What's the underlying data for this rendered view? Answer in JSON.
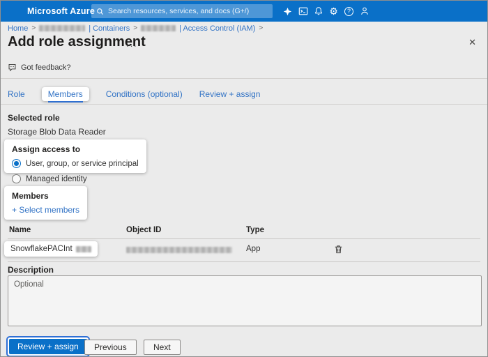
{
  "colors": {
    "topbar_blue": "#0a70c8",
    "accent_blue": "#0078d4",
    "link_blue": "#3273c5",
    "page_dim_gray": "#ebebeb",
    "highlight_white": "#ffffff"
  },
  "topbar": {
    "brand": "Microsoft Azure",
    "search_placeholder": "Search resources, services, and docs (G+/)",
    "gear_glyph": "⚙",
    "help_glyph": "?"
  },
  "breadcrumb": {
    "home": "Home",
    "separator": ">",
    "containers_label": "| Containers",
    "iam_label": "| Access Control (IAM)"
  },
  "page": {
    "title": "Add role assignment",
    "more_glyph": "···",
    "close_glyph": "✕",
    "feedback_label": "Got feedback?"
  },
  "tabs": [
    {
      "label": "Role",
      "active": false
    },
    {
      "label": "Members",
      "active": true
    },
    {
      "label": "Conditions (optional)",
      "active": false
    },
    {
      "label": "Review + assign",
      "active": false
    }
  ],
  "selected_role": {
    "label": "Selected role",
    "value": "Storage Blob Data Reader"
  },
  "assign_access": {
    "label": "Assign access to",
    "options": [
      {
        "label": "User, group, or service principal",
        "selected": true
      },
      {
        "label": "Managed identity",
        "selected": false
      }
    ]
  },
  "members": {
    "label": "Members",
    "select_link": "+ Select members"
  },
  "table": {
    "headers": [
      "Name",
      "Object ID",
      "Type"
    ],
    "rows": [
      {
        "name": "SnowflakePACInt",
        "type": "App"
      }
    ]
  },
  "description": {
    "label": "Description",
    "placeholder": "Optional"
  },
  "footer": {
    "review_assign": "Review + assign",
    "previous": "Previous",
    "next": "Next"
  }
}
